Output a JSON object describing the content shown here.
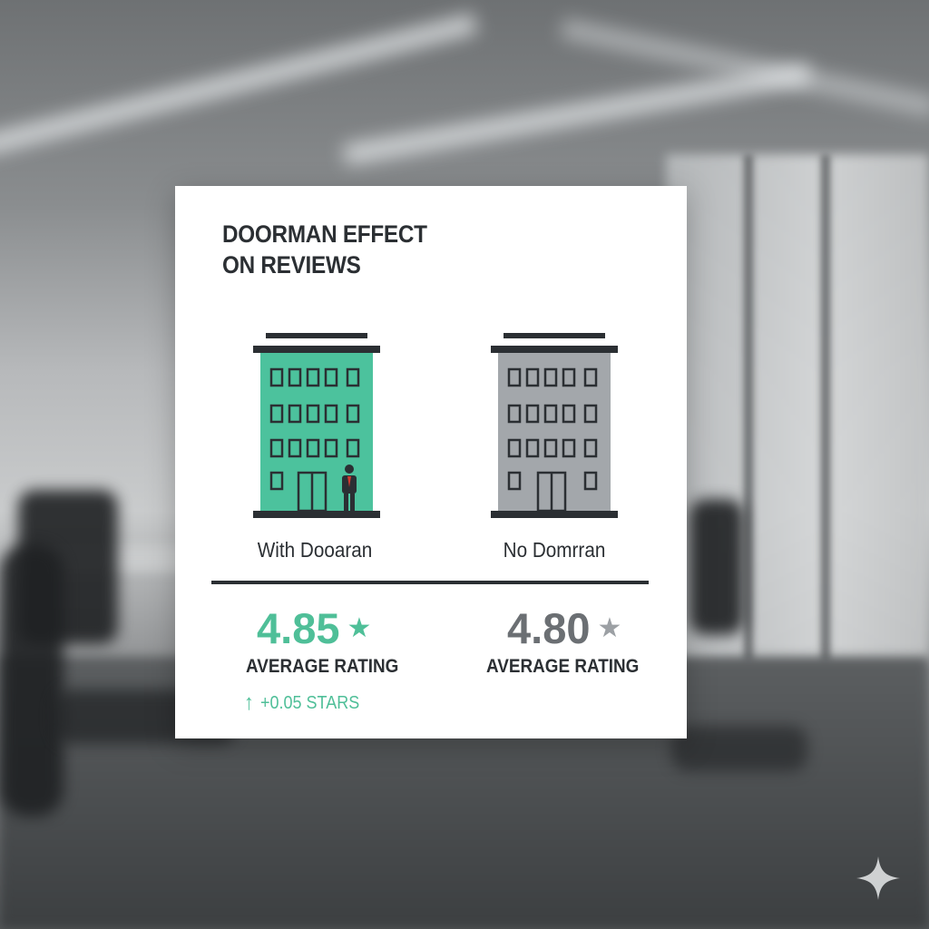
{
  "infographic": {
    "title_line1": "DOORMAN EFFECT",
    "title_line2": "ON REVIEWS",
    "left": {
      "label": "With Dooaran",
      "rating": "4.85",
      "star": "★",
      "caption": "AVERAGE RATING",
      "delta": "+0.05 STARS",
      "delta_arrow": "↑",
      "color": "#4fbf98"
    },
    "right": {
      "label": "No Domrran",
      "rating": "4.80",
      "star": "★",
      "caption": "AVERAGE RATING",
      "color": "#9ca0a4"
    }
  },
  "icons": {
    "left_building": "building-with-doorman-icon",
    "right_building": "building-icon",
    "watermark": "sparkle-icon"
  }
}
